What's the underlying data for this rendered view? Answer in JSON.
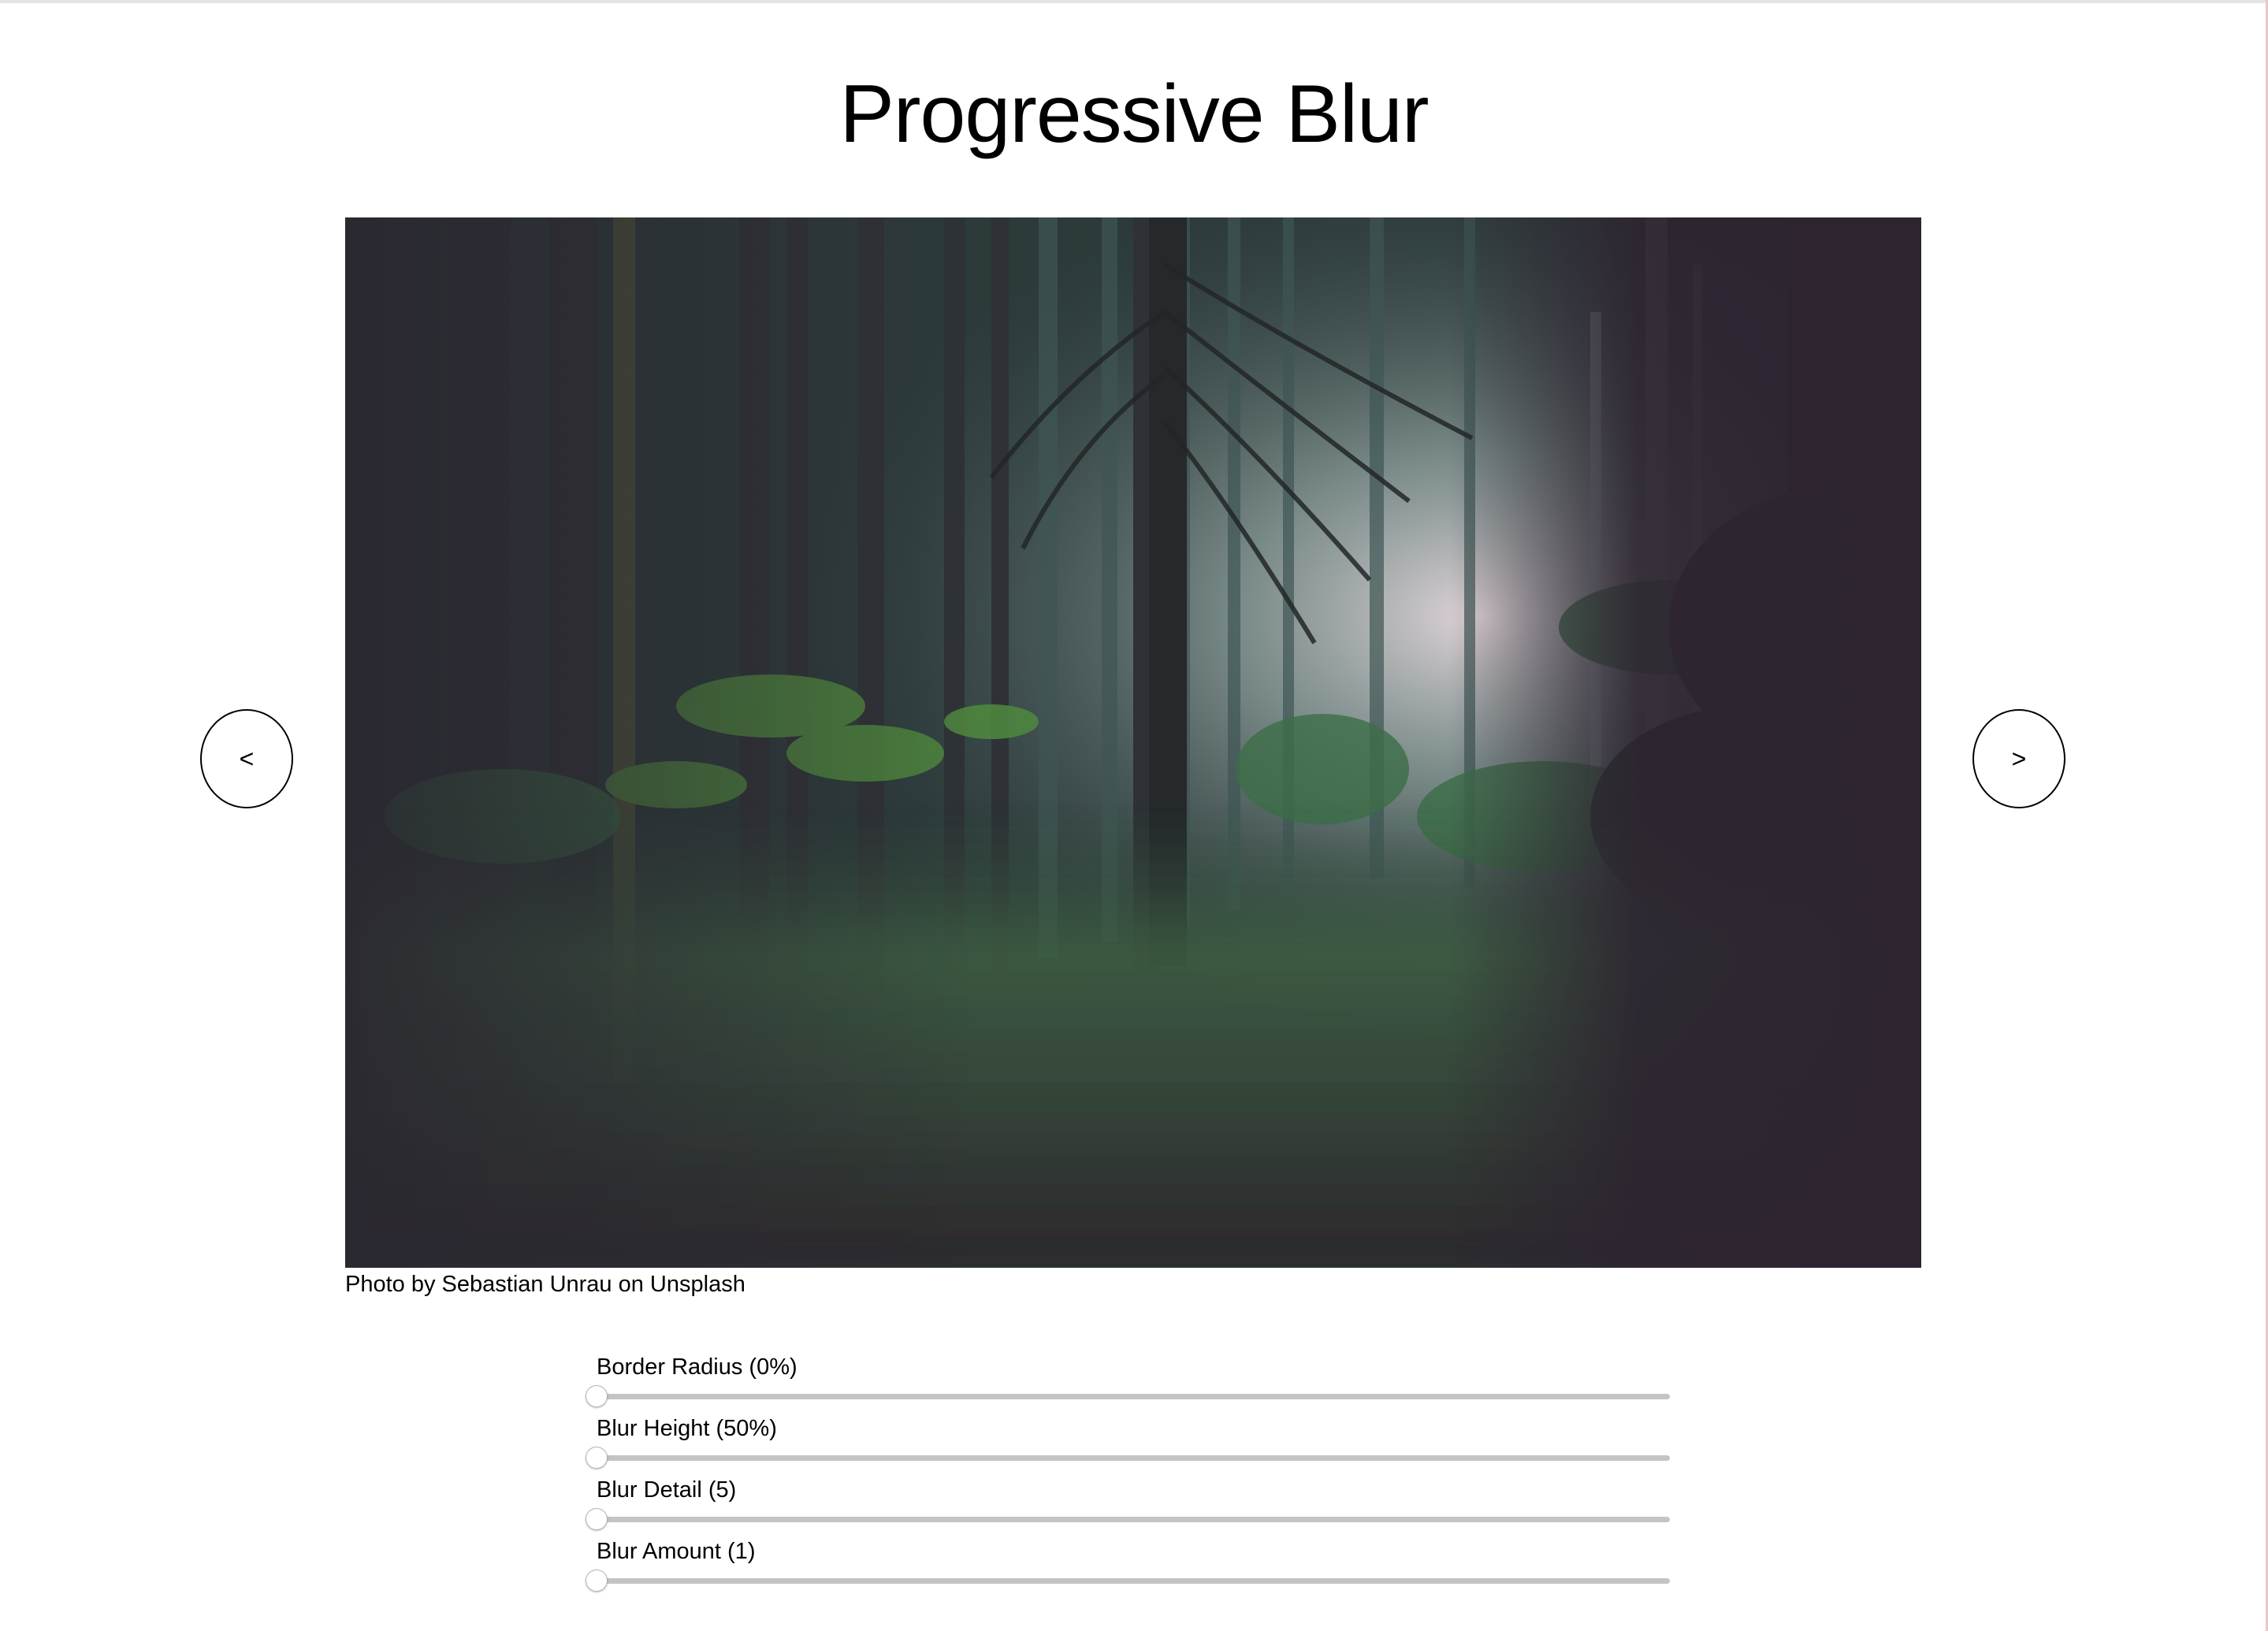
{
  "page": {
    "title": "Progressive Blur"
  },
  "gallery": {
    "prev_label": "<",
    "next_label": ">",
    "caption": "Photo by Sebastian Unrau on Unsplash"
  },
  "controls": [
    {
      "label": "Border Radius (0%)",
      "value_fraction": 0
    },
    {
      "label": "Blur Height (50%)",
      "value_fraction": 0
    },
    {
      "label": "Blur Detail (5)",
      "value_fraction": 0
    },
    {
      "label": "Blur Amount (1)",
      "value_fraction": 0
    }
  ],
  "colors": {
    "slider_track": "#c4c4c4",
    "accent_light": "#e9d9e0",
    "foliage": "#5b8f45",
    "shadow": "#2c2530"
  },
  "icons": {
    "prev": "chevron-left-icon",
    "next": "chevron-right-icon"
  }
}
